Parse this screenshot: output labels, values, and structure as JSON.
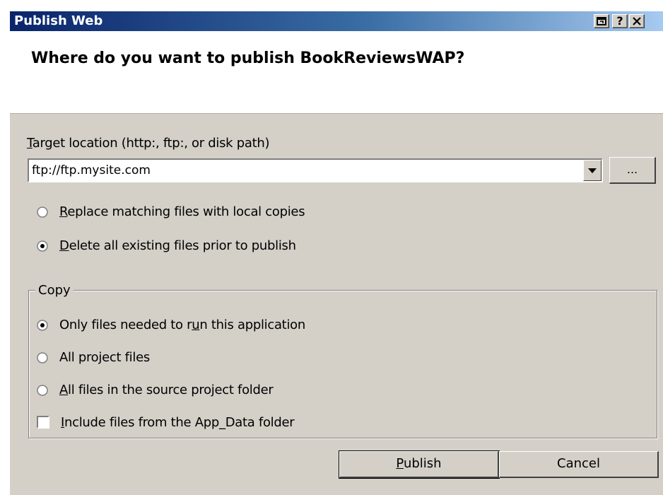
{
  "window": {
    "title": "Publish Web",
    "buttons": {
      "restore": "⧉",
      "help": "?",
      "close": "✕"
    }
  },
  "header": {
    "heading": "Where do you want to publish BookReviewsWAP?"
  },
  "target": {
    "label_mnemonic": "T",
    "label_rest": "arget location (http:, ftp:, or disk path)",
    "value": "ftp://ftp.mysite.com",
    "browse_label": "..."
  },
  "mode": {
    "replace": {
      "mn": "R",
      "rest": "eplace matching files with local copies",
      "checked": false
    },
    "delete": {
      "mn": "D",
      "rest": "elete all existing files prior to publish",
      "checked": true
    }
  },
  "copy": {
    "legend": "Copy",
    "only_needed": {
      "pre": "Only files needed to r",
      "mn": "u",
      "post": "n this application",
      "checked": true
    },
    "all_project": {
      "pre": "All pro",
      "mn": "j",
      "post": "ect files",
      "checked": false
    },
    "all_source": {
      "pre": "",
      "mn": "A",
      "post": "ll files in the source project folder",
      "checked": false
    },
    "include_appdata": {
      "pre": "",
      "mn": "I",
      "post": "nclude files from the App_Data folder",
      "checked": false
    }
  },
  "actions": {
    "publish_mn": "P",
    "publish_rest": "ublish",
    "cancel": "Cancel"
  }
}
